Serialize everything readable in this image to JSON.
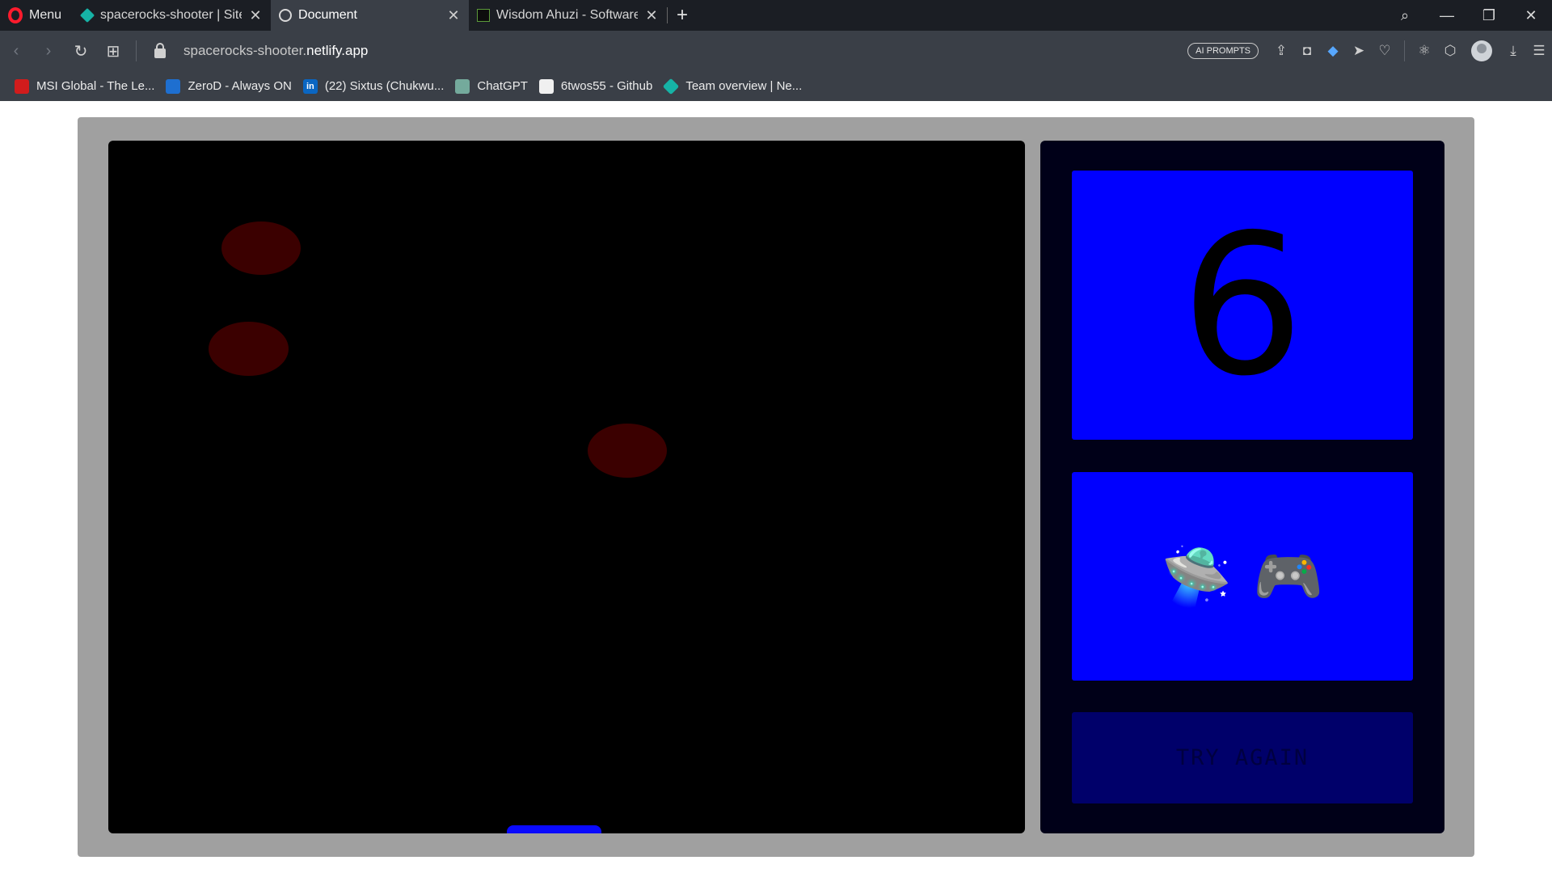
{
  "browser": {
    "menu_label": "Menu",
    "tabs": [
      {
        "title": "spacerocks-shooter | Site o",
        "icon": "netlify-diamond-icon"
      },
      {
        "title": "Document",
        "icon": "globe-icon"
      },
      {
        "title": "Wisdom Ahuzi - Software E",
        "icon": "terminal-icon"
      }
    ],
    "url_host": "spacerocks-shooter.",
    "url_domain": "netlify.app",
    "ai_prompts_label": "AI PROMPTS",
    "bookmarks": [
      {
        "label": "MSI Global - The Le...",
        "icon": "msi-icon"
      },
      {
        "label": "ZeroD - Always ON",
        "icon": "zerod-icon"
      },
      {
        "label": "(22) Sixtus (Chukwu...",
        "icon": "linkedin-icon"
      },
      {
        "label": "ChatGPT",
        "icon": "chatgpt-icon"
      },
      {
        "label": "6twos55 - Github",
        "icon": "github-icon"
      },
      {
        "label": "Team overview | Ne...",
        "icon": "netlify-diamond-icon"
      }
    ]
  },
  "game": {
    "score": "6",
    "emojis": [
      "🛸",
      "🎮"
    ],
    "retry_label": "TRY AGAIN",
    "colors": {
      "frame": "#a0a0a0",
      "canvas": "#000000",
      "rock": "#3b0000",
      "panel": "#0000ff",
      "paddle": "#0a0aff"
    }
  }
}
